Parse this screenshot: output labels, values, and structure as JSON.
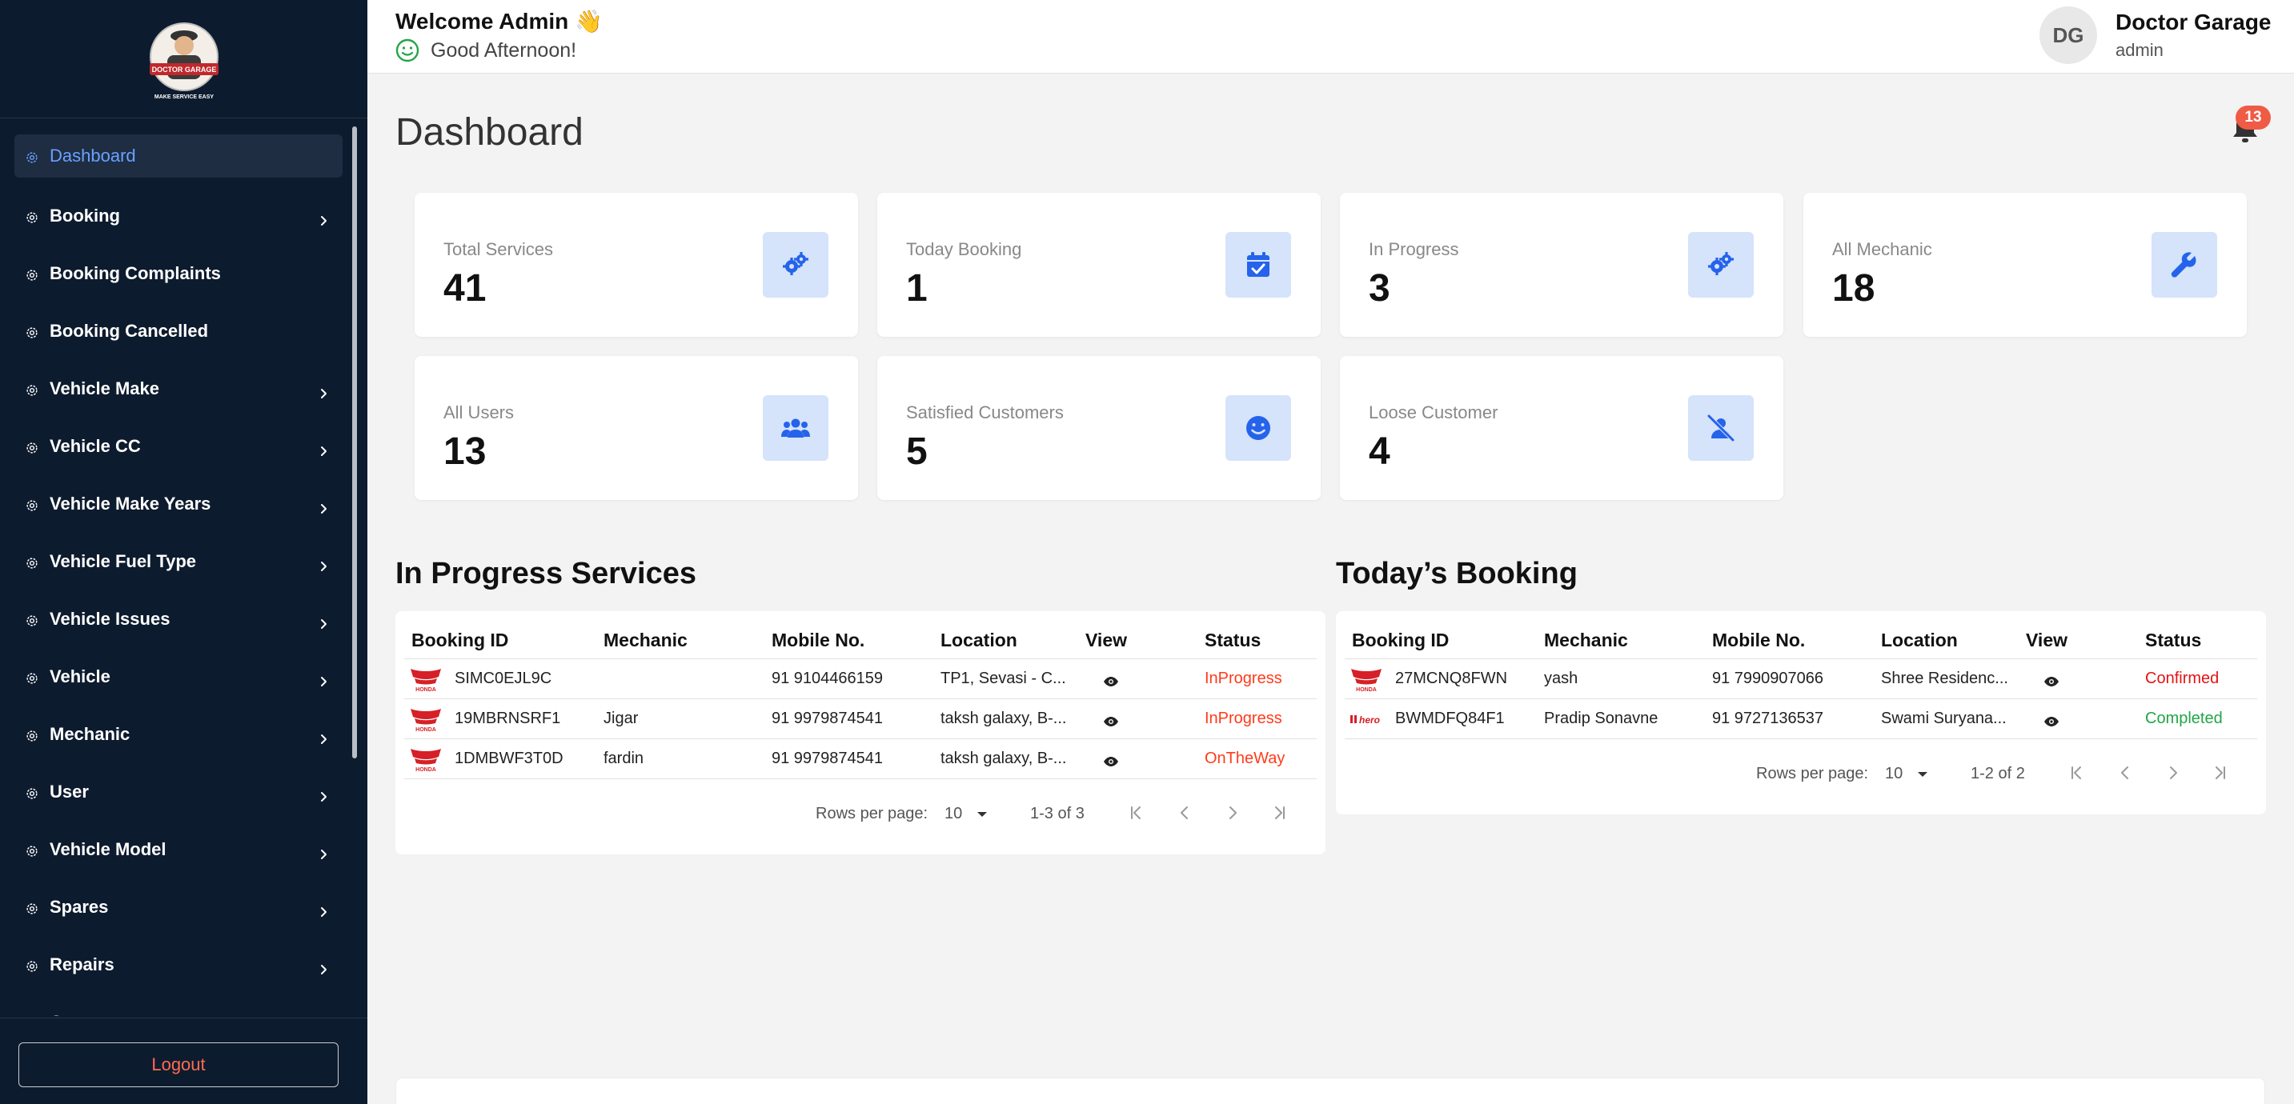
{
  "sidebar": {
    "logo_text": "DOCTOR GARAGE",
    "logo_tagline": "MAKE SERVICE EASY",
    "items": [
      {
        "label": "Dashboard",
        "active": true,
        "has_children": false
      },
      {
        "label": "Booking",
        "active": false,
        "has_children": true
      },
      {
        "label": "Booking Complaints",
        "active": false,
        "has_children": false
      },
      {
        "label": "Booking Cancelled",
        "active": false,
        "has_children": false
      },
      {
        "label": "Vehicle Make",
        "active": false,
        "has_children": true
      },
      {
        "label": "Vehicle CC",
        "active": false,
        "has_children": true
      },
      {
        "label": "Vehicle Make Years",
        "active": false,
        "has_children": true
      },
      {
        "label": "Vehicle Fuel Type",
        "active": false,
        "has_children": true
      },
      {
        "label": "Vehicle Issues",
        "active": false,
        "has_children": true
      },
      {
        "label": "Vehicle",
        "active": false,
        "has_children": true
      },
      {
        "label": "Mechanic",
        "active": false,
        "has_children": true
      },
      {
        "label": "User",
        "active": false,
        "has_children": true
      },
      {
        "label": "Vehicle Model",
        "active": false,
        "has_children": true
      },
      {
        "label": "Spares",
        "active": false,
        "has_children": true
      },
      {
        "label": "Repairs",
        "active": false,
        "has_children": true
      },
      {
        "label": "Coupons",
        "active": false,
        "has_children": true
      }
    ],
    "logout_label": "Logout"
  },
  "header": {
    "welcome": "Welcome Admin",
    "welcome_emoji": "👋",
    "greeting": "Good Afternoon!",
    "avatar_initials": "DG",
    "user_name": "Doctor Garage",
    "user_role": "admin"
  },
  "page": {
    "title": "Dashboard",
    "notification_count": "13"
  },
  "stats": [
    {
      "label": "Total Services",
      "value": "41",
      "icon": "gears-icon"
    },
    {
      "label": "Today Booking",
      "value": "1",
      "icon": "calendar-check-icon"
    },
    {
      "label": "In Progress",
      "value": "3",
      "icon": "gears-icon"
    },
    {
      "label": "All Mechanic",
      "value": "18",
      "icon": "wrench-icon"
    },
    {
      "label": "All Users",
      "value": "13",
      "icon": "users-icon"
    },
    {
      "label": "Satisfied Customers",
      "value": "5",
      "icon": "smile-icon"
    },
    {
      "label": "Loose Customer",
      "value": "4",
      "icon": "user-slash-icon"
    }
  ],
  "in_progress": {
    "title": "In Progress Services",
    "columns": [
      "Booking ID",
      "Mechanic",
      "Mobile No.",
      "Location",
      "View",
      "Status"
    ],
    "rows": [
      {
        "brand": "honda",
        "booking_id": "SIMC0EJL9C",
        "mechanic": "",
        "mobile": "91 9104466159",
        "location": "TP1, Sevasi - C...",
        "status": "InProgress"
      },
      {
        "brand": "honda",
        "booking_id": "19MBRNSRF1",
        "mechanic": "Jigar",
        "mobile": "91 9979874541",
        "location": "taksh galaxy, B-...",
        "status": "InProgress"
      },
      {
        "brand": "honda",
        "booking_id": "1DMBWF3T0D",
        "mechanic": "fardin",
        "mobile": "91 9979874541",
        "location": "taksh galaxy, B-...",
        "status": "OnTheWay"
      }
    ],
    "rows_per_page_label": "Rows per page:",
    "rows_per_page": "10",
    "range": "1-3 of 3"
  },
  "todays_booking": {
    "title": "Today’s Booking",
    "columns": [
      "Booking ID",
      "Mechanic",
      "Mobile No.",
      "Location",
      "View",
      "Status"
    ],
    "rows": [
      {
        "brand": "honda",
        "booking_id": "27MCNQ8FWN",
        "mechanic": "yash",
        "mobile": "91 7990907066",
        "location": "Shree Residenc...",
        "status": "Confirmed"
      },
      {
        "brand": "hero",
        "booking_id": "BWMDFQ84F1",
        "mechanic": "Pradip Sonavne",
        "mobile": "91 9727136537",
        "location": "Swami Suryana...",
        "status": "Completed"
      }
    ],
    "rows_per_page_label": "Rows per page:",
    "rows_per_page": "10",
    "range": "1-2 of 2"
  },
  "colors": {
    "sidebar_bg": "#0d1b2e",
    "accent": "#2563eb",
    "status_inprogress": "#ff3b1a",
    "status_confirmed": "#e31414",
    "status_completed": "#22a547"
  }
}
